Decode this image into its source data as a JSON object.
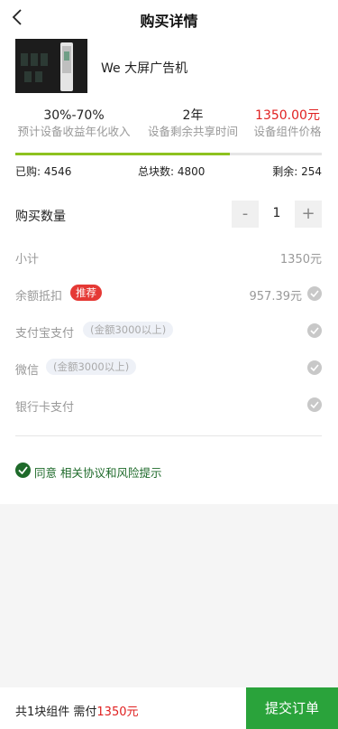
{
  "header": {
    "title": "购买详情"
  },
  "product": {
    "name": "We 大屏广告机"
  },
  "stats": [
    {
      "value": "30%-70%",
      "label": "预计设备收益年化收入"
    },
    {
      "value": "2年",
      "label": "设备剩余共享时间"
    },
    {
      "value": "1350.00元",
      "label": "设备组件价格"
    }
  ],
  "progress": {
    "fraction": 0.7
  },
  "counts": {
    "bought": "已购: 4546",
    "total": "总块数: 4800",
    "remaining": "剩余: 254"
  },
  "quantity": {
    "label": "购买数量",
    "minus": "-",
    "value": "1",
    "plus": "+"
  },
  "subtotal": {
    "label": "小计",
    "value": "1350元"
  },
  "balance": {
    "label": "余额抵扣",
    "badge": "推荐",
    "value": "957.39元"
  },
  "alipay": {
    "label": "支付宝支付",
    "chip": "(金额3000以上)"
  },
  "wechat": {
    "label": "微信",
    "chip": "(金额3000以上)"
  },
  "bankcard": {
    "label": "银行卡支付"
  },
  "agreement": {
    "text": "同意 相关协议和风险提示"
  },
  "footer": {
    "prefix": "共1块组件 需付",
    "price": "1350元",
    "submit": "提交订单"
  },
  "colors": {
    "accent": "#2aa33b",
    "price": "#e02020",
    "progress": "#8dc21f",
    "badge": "#e53935"
  }
}
